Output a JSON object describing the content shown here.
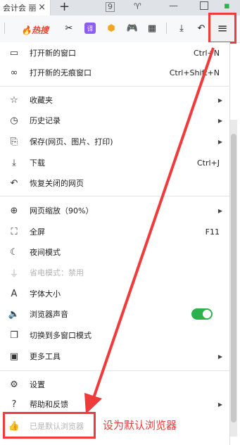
{
  "tab": {
    "title": "会计会 丽",
    "close": "×",
    "new": "+"
  },
  "toolbar": {
    "hot_label": "热搜"
  },
  "menu": {
    "items": [
      {
        "label": "打开新的窗口",
        "shortcut": "Ctrl+N",
        "icon": "window-icon"
      },
      {
        "label": "打开新的无痕窗口",
        "shortcut": "Ctrl+Shift+N",
        "icon": "incognito-icon"
      },
      {
        "label": "收藏夹",
        "icon": "star-list-icon"
      },
      {
        "label": "历史记录",
        "icon": "clock-icon"
      },
      {
        "label": "保存(网页、图片、打印)",
        "icon": "save-icon"
      },
      {
        "label": "下载",
        "shortcut": "Ctrl+J",
        "icon": "download-icon"
      },
      {
        "label": "恢复关闭的网页",
        "icon": "undo-icon"
      },
      {
        "label": "网页缩放（90%）",
        "icon": "zoom-icon"
      },
      {
        "label": "全屏",
        "shortcut": "F11",
        "icon": "fullscreen-icon"
      },
      {
        "label": "夜间模式",
        "icon": "moon-icon"
      },
      {
        "label": "省电模式：禁用",
        "icon": "plug-icon"
      },
      {
        "label": "字体大小",
        "icon": "font-icon"
      },
      {
        "label": "浏览器声音",
        "icon": "speaker-icon"
      },
      {
        "label": "切换到多窗口模式",
        "icon": "multiwindow-icon"
      },
      {
        "label": "更多工具",
        "icon": "toolbox-icon"
      },
      {
        "label": "设置",
        "icon": "gear-icon"
      },
      {
        "label": "帮助和反馈",
        "icon": "help-icon"
      },
      {
        "label": "已是默认浏览器",
        "icon": "thumbs-up-icon"
      }
    ]
  },
  "annotation": {
    "text": "设为默认浏览器",
    "color": "#ef3b3b"
  }
}
